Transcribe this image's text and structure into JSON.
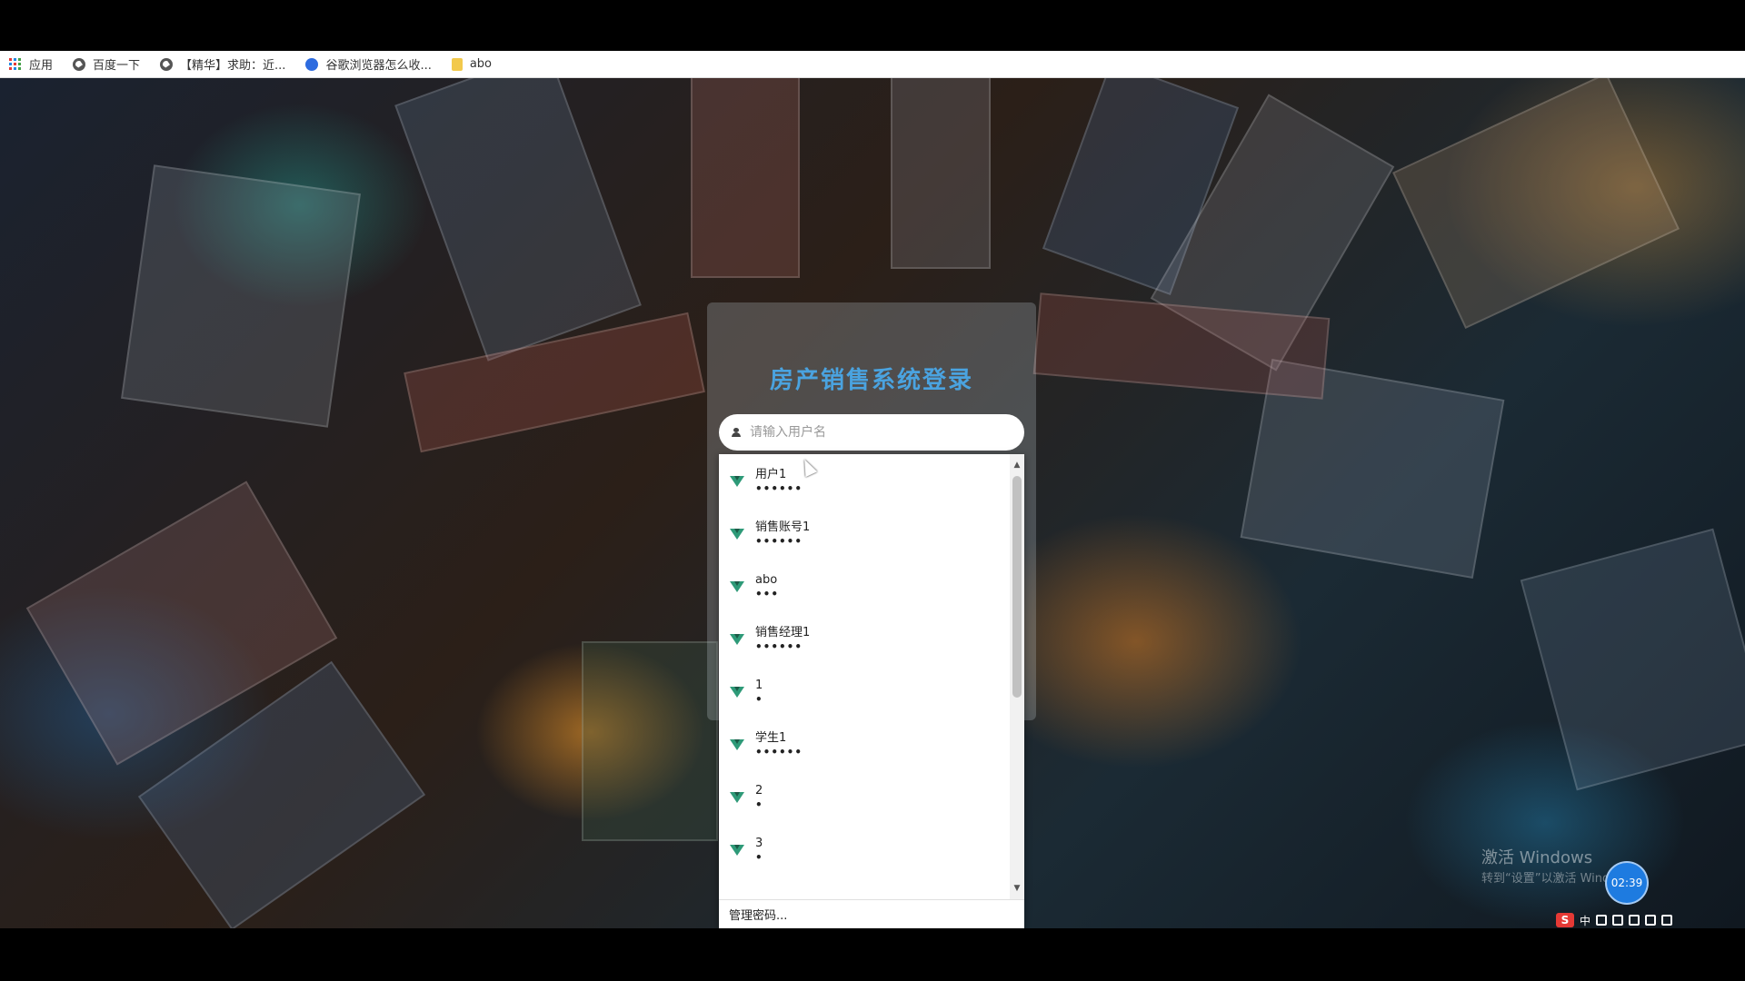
{
  "bookmarks": [
    {
      "label": "应用",
      "icon": "apps-icon"
    },
    {
      "label": "百度一下",
      "icon": "globe-icon"
    },
    {
      "label": "【精华】求助：近...",
      "icon": "globe-icon"
    },
    {
      "label": "谷歌浏览器怎么收...",
      "icon": "paw-icon"
    },
    {
      "label": "abo",
      "icon": "folder-icon"
    }
  ],
  "login": {
    "title": "房产销售系统登录",
    "username_placeholder": "请输入用户名"
  },
  "saved_credentials": [
    {
      "username": "用户1",
      "password_mask": "••••••"
    },
    {
      "username": "销售账号1",
      "password_mask": "••••••"
    },
    {
      "username": "abo",
      "password_mask": "•••"
    },
    {
      "username": "销售经理1",
      "password_mask": "••••••"
    },
    {
      "username": "1",
      "password_mask": "•"
    },
    {
      "username": "学生1",
      "password_mask": "••••••"
    },
    {
      "username": "2",
      "password_mask": "•"
    },
    {
      "username": "3",
      "password_mask": "•"
    }
  ],
  "dropdown_footer": "管理密码...",
  "watermark": {
    "line1": "激活 Windows",
    "line2": "转到“设置”以激活 Windows。"
  },
  "timer": "02:39",
  "tray": {
    "ime_logo": "S",
    "ime_label": "中"
  },
  "colors": {
    "title": "#4aa3e0",
    "key_icon": "#2e9a78",
    "timer_badge": "#1e7be0"
  }
}
